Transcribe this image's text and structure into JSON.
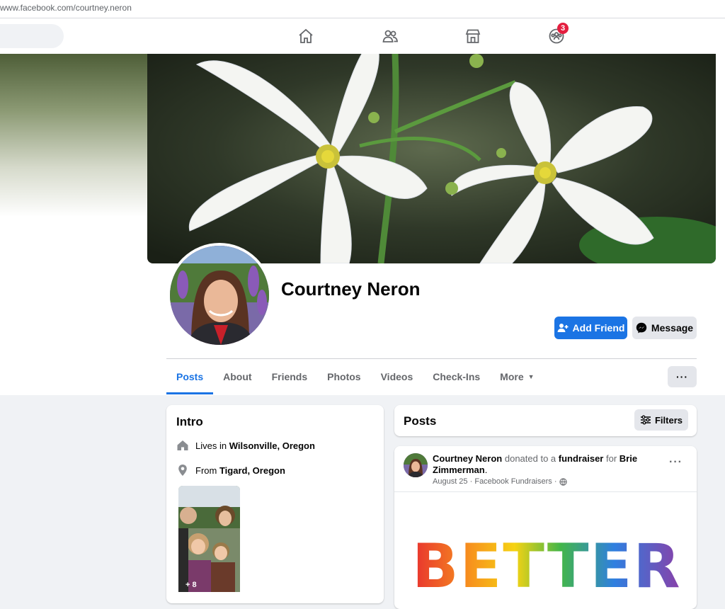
{
  "browser": {
    "url": "www.facebook.com/courtney.neron"
  },
  "nav": {
    "icons": [
      "home-icon",
      "friends-icon",
      "marketplace-icon",
      "groups-icon"
    ],
    "groups_badge": "3"
  },
  "profile": {
    "name": "Courtney Neron",
    "add_friend_label": "Add Friend",
    "message_label": "Message",
    "more_dots": "···"
  },
  "tabs": [
    {
      "label": "Posts",
      "active": true
    },
    {
      "label": "About"
    },
    {
      "label": "Friends"
    },
    {
      "label": "Photos"
    },
    {
      "label": "Videos"
    },
    {
      "label": "Check-Ins"
    },
    {
      "label": "More"
    }
  ],
  "intro": {
    "title": "Intro",
    "lives_prefix": "Lives in",
    "lives_place": "Wilsonville, Oregon",
    "from_prefix": "From",
    "from_place": "Tigard, Oregon",
    "photo_more": "+ 8"
  },
  "posts_header": {
    "title": "Posts",
    "filters_label": "Filters"
  },
  "post": {
    "author": "Courtney Neron",
    "action1": "donated to a",
    "fundraiser": "fundraiser",
    "action2": "for",
    "target": "Brie Zimmerman",
    "period": ".",
    "date": "August 25",
    "sep": "·",
    "source": "Facebook Fundraisers",
    "sep2": "·",
    "dots": "···",
    "image_text": "BETTER"
  },
  "colors": {
    "accent": "#1b74e4",
    "badge": "#e41e3f",
    "text_muted": "#65676b"
  }
}
